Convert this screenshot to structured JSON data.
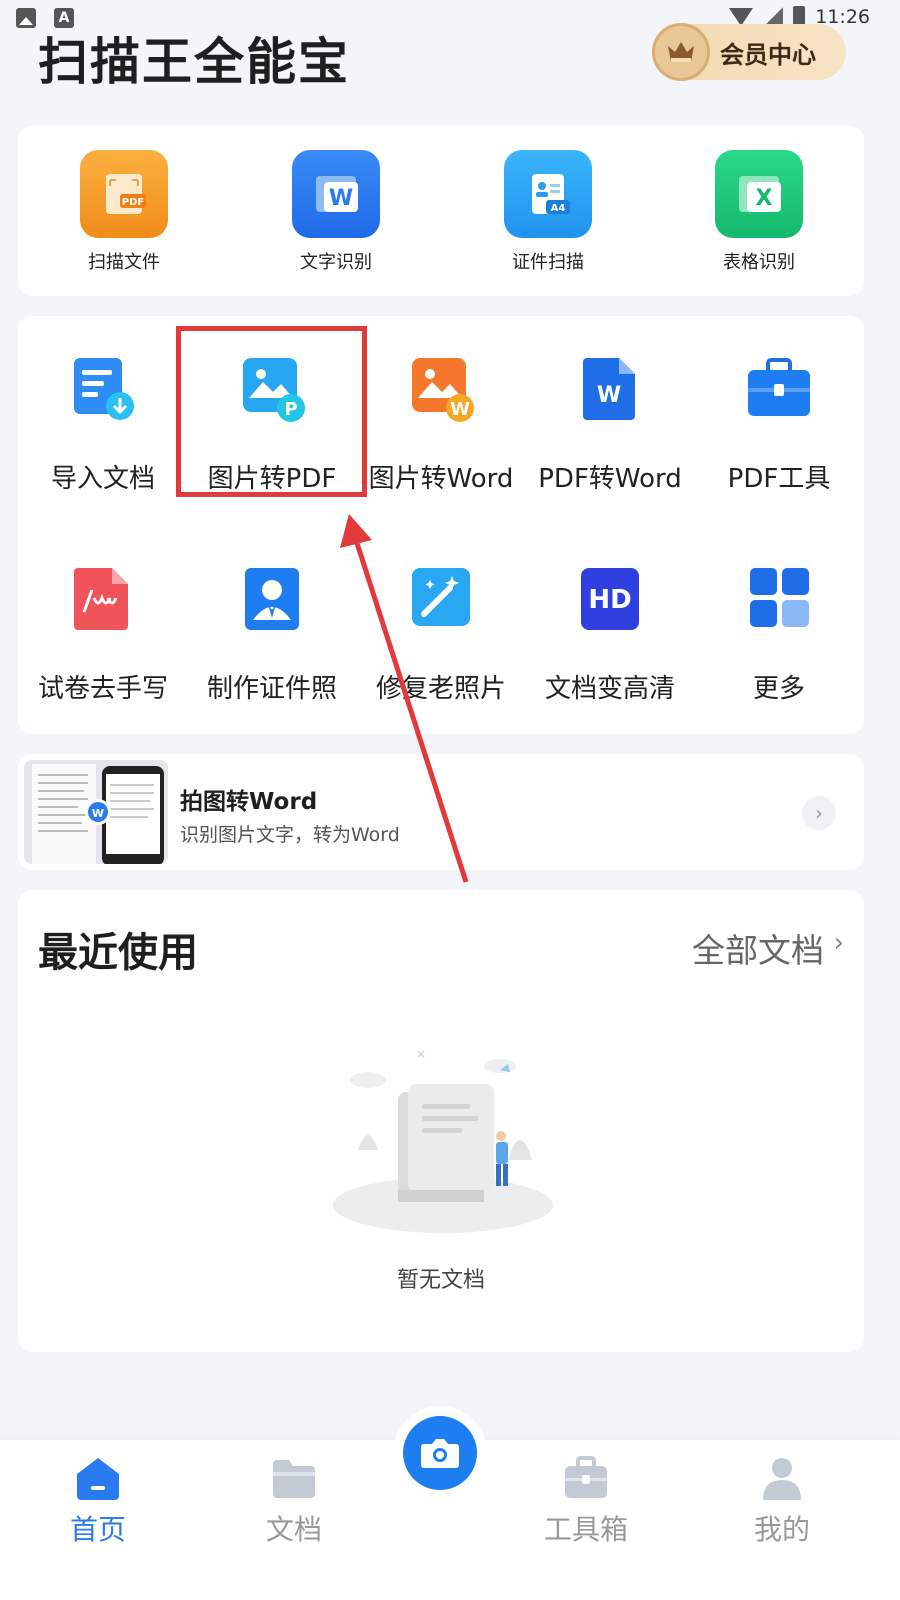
{
  "status_bar": {
    "time": "11:26"
  },
  "header": {
    "app_title": "扫描王全能宝",
    "vip_label": "会员中心"
  },
  "primary_tools": [
    {
      "label": "扫描文件",
      "icon": "scan-pdf-icon",
      "color": "#f59a23"
    },
    {
      "label": "文字识别",
      "icon": "word-ocr-icon",
      "color": "#2d7bf3"
    },
    {
      "label": "证件扫描",
      "icon": "id-card-icon",
      "color": "#29a7f5"
    },
    {
      "label": "表格识别",
      "icon": "excel-icon",
      "color": "#1dc97a"
    }
  ],
  "icon_badges": {
    "pdf": "PDF",
    "word": "W",
    "a4": "A4",
    "excel": "X",
    "pdf_p": "P",
    "hd": "HD"
  },
  "tools_row1": [
    {
      "label": "导入文档",
      "icon": "import-doc-icon"
    },
    {
      "label": "图片转PDF",
      "icon": "image-to-pdf-icon"
    },
    {
      "label": "图片转Word",
      "icon": "image-to-word-icon"
    },
    {
      "label": "PDF转Word",
      "icon": "pdf-to-word-icon"
    },
    {
      "label": "PDF工具",
      "icon": "pdf-tools-icon"
    }
  ],
  "tools_row2": [
    {
      "label": "试卷去手写",
      "icon": "remove-handwriting-icon"
    },
    {
      "label": "制作证件照",
      "icon": "id-photo-icon"
    },
    {
      "label": "修复老照片",
      "icon": "magic-wand-icon"
    },
    {
      "label": "文档变高清",
      "icon": "hd-icon"
    },
    {
      "label": "更多",
      "icon": "grid-more-icon"
    }
  ],
  "promo": {
    "title": "拍图转Word",
    "subtitle": "识别图片文字，转为Word"
  },
  "recent": {
    "title": "最近使用",
    "all_docs": "全部文档",
    "empty_text": "暂无文档"
  },
  "bottom_nav": {
    "items": [
      {
        "label": "首页",
        "icon": "home-icon",
        "active": true
      },
      {
        "label": "文档",
        "icon": "folder-icon",
        "active": false
      },
      {
        "label": "工具箱",
        "icon": "toolbox-icon",
        "active": false
      },
      {
        "label": "我的",
        "icon": "user-icon",
        "active": false
      }
    ]
  },
  "colors": {
    "accent": "#2b7bf0",
    "highlight": "#e23a3a"
  }
}
